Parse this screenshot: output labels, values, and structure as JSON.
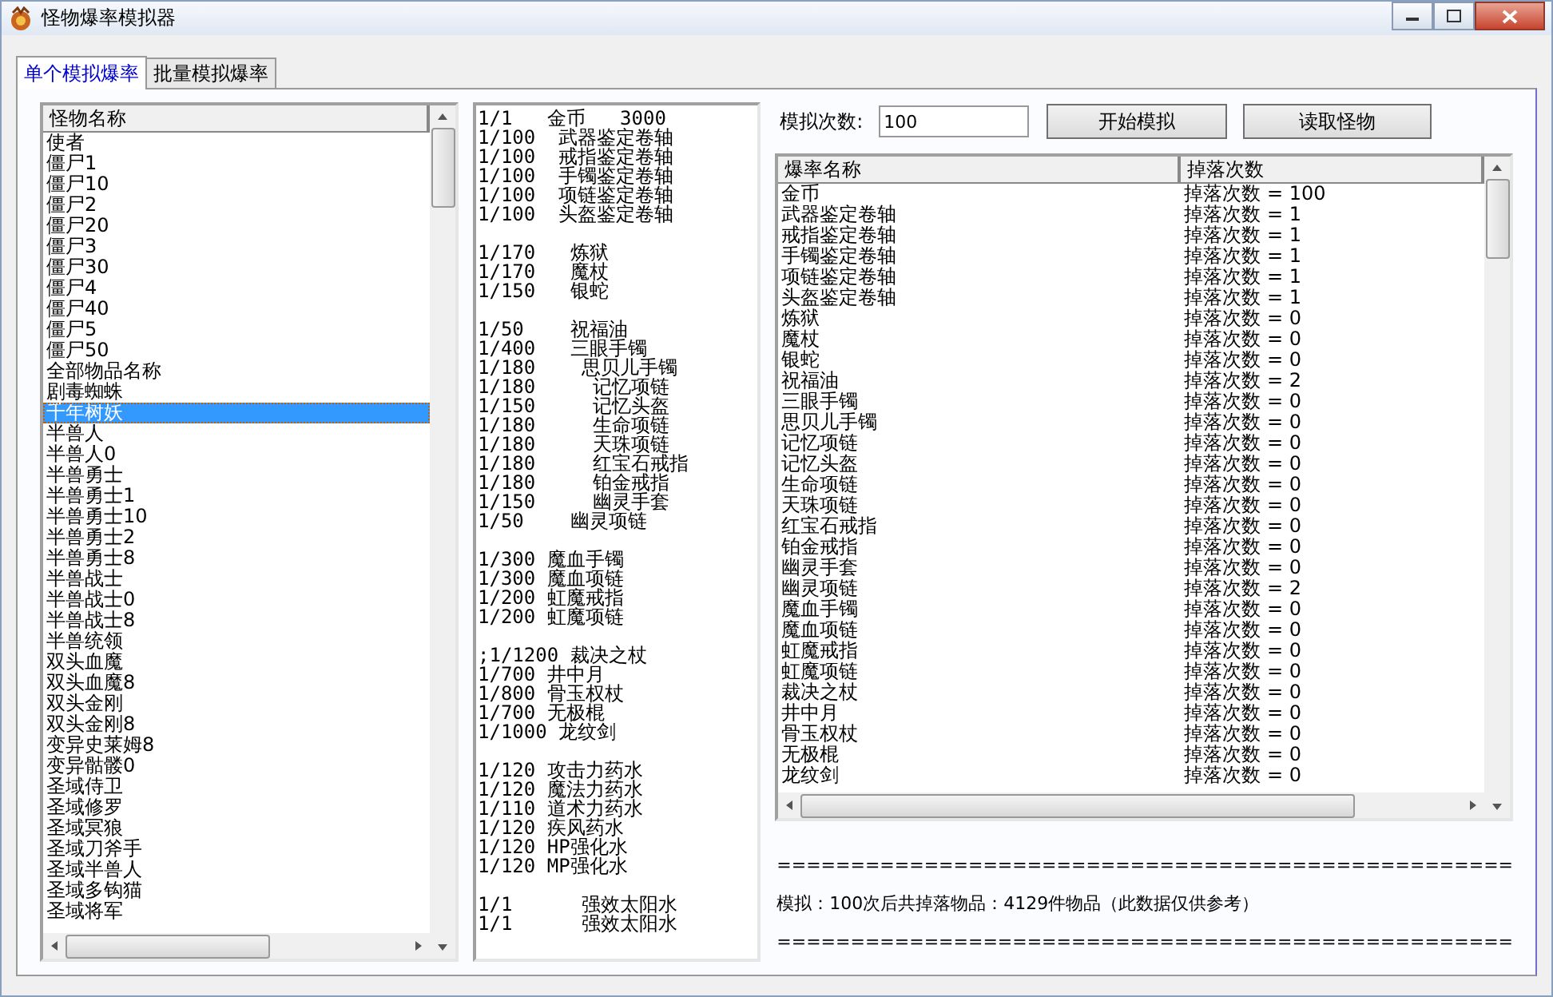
{
  "window": {
    "title": "怪物爆率模拟器"
  },
  "tabs": [
    {
      "label": "单个模拟爆率",
      "selected": true
    },
    {
      "label": "批量模拟爆率",
      "selected": false
    }
  ],
  "monster_list": {
    "header": "怪物名称",
    "items": [
      {
        "label": "使者",
        "selected": false
      },
      {
        "label": "僵尸1",
        "selected": false
      },
      {
        "label": "僵尸10",
        "selected": false
      },
      {
        "label": "僵尸2",
        "selected": false
      },
      {
        "label": "僵尸20",
        "selected": false
      },
      {
        "label": "僵尸3",
        "selected": false
      },
      {
        "label": "僵尸30",
        "selected": false
      },
      {
        "label": "僵尸4",
        "selected": false
      },
      {
        "label": "僵尸40",
        "selected": false
      },
      {
        "label": "僵尸5",
        "selected": false
      },
      {
        "label": "僵尸50",
        "selected": false
      },
      {
        "label": "全部物品名称",
        "selected": false
      },
      {
        "label": "剧毒蜘蛛",
        "selected": false
      },
      {
        "label": "千年树妖",
        "selected": true
      },
      {
        "label": "半兽人",
        "selected": false
      },
      {
        "label": "半兽人0",
        "selected": false
      },
      {
        "label": "半兽勇士",
        "selected": false
      },
      {
        "label": "半兽勇士1",
        "selected": false
      },
      {
        "label": "半兽勇士10",
        "selected": false
      },
      {
        "label": "半兽勇士2",
        "selected": false
      },
      {
        "label": "半兽勇士8",
        "selected": false
      },
      {
        "label": "半兽战士",
        "selected": false
      },
      {
        "label": "半兽战士0",
        "selected": false
      },
      {
        "label": "半兽战士8",
        "selected": false
      },
      {
        "label": "半兽统领",
        "selected": false
      },
      {
        "label": "双头血魔",
        "selected": false
      },
      {
        "label": "双头血魔8",
        "selected": false
      },
      {
        "label": "双头金刚",
        "selected": false
      },
      {
        "label": "双头金刚8",
        "selected": false
      },
      {
        "label": "变异史莱姆8",
        "selected": false
      },
      {
        "label": "变异骷髅0",
        "selected": false
      },
      {
        "label": "圣域侍卫",
        "selected": false
      },
      {
        "label": "圣域修罗",
        "selected": false
      },
      {
        "label": "圣域冥狼",
        "selected": false
      },
      {
        "label": "圣域刀斧手",
        "selected": false
      },
      {
        "label": "圣域半兽人",
        "selected": false
      },
      {
        "label": "圣域多钩猫",
        "selected": false
      },
      {
        "label": "圣域将军",
        "selected": false
      }
    ]
  },
  "drop_script": [
    [
      "1/1   金币   3000",
      "1/100  武器鉴定卷轴",
      "1/100  戒指鉴定卷轴",
      "1/100  手镯鉴定卷轴",
      "1/100  项链鉴定卷轴",
      "1/100  头盔鉴定卷轴"
    ],
    [
      "1/170   炼狱",
      "1/170   魔杖",
      "1/150   银蛇"
    ],
    [
      "1/50    祝福油",
      "1/400   三眼手镯",
      "1/180    思贝儿手镯",
      "1/180     记忆项链",
      "1/150     记忆头盔",
      "1/180     生命项链",
      "1/180     天珠项链",
      "1/180     红宝石戒指",
      "1/180     铂金戒指",
      "1/150     幽灵手套",
      "1/50    幽灵项链"
    ],
    [
      "1/300 魔血手镯",
      "1/300 魔血项链",
      "1/200 虹魔戒指",
      "1/200 虹魔项链"
    ],
    [
      ";1/1200 裁决之杖",
      "1/700 井中月",
      "1/800 骨玉权杖",
      "1/700 无极棍",
      "1/1000 龙纹剑"
    ],
    [
      "1/120 攻击力药水",
      "1/120 魔法力药水",
      "1/110 道术力药水",
      "1/120 疾风药水",
      "1/120 HP强化水",
      "1/120 MP强化水"
    ],
    [
      "1/1      强效太阳水",
      "1/1      强效太阳水"
    ]
  ],
  "simulation": {
    "count_label": "模拟次数:",
    "count_value": "100",
    "buttons": [
      "开始模拟",
      "读取怪物"
    ]
  },
  "results_table": {
    "columns": [
      "爆率名称",
      "掉落次数"
    ],
    "rows": [
      [
        "金币",
        "掉落次数 = 100"
      ],
      [
        "武器鉴定卷轴",
        "掉落次数 = 1"
      ],
      [
        "戒指鉴定卷轴",
        "掉落次数 = 1"
      ],
      [
        "手镯鉴定卷轴",
        "掉落次数 = 1"
      ],
      [
        "项链鉴定卷轴",
        "掉落次数 = 1"
      ],
      [
        "头盔鉴定卷轴",
        "掉落次数 = 1"
      ],
      [
        "炼狱",
        "掉落次数 = 0"
      ],
      [
        "魔杖",
        "掉落次数 = 0"
      ],
      [
        "银蛇",
        "掉落次数 = 0"
      ],
      [
        "祝福油",
        "掉落次数 = 2"
      ],
      [
        "三眼手镯",
        "掉落次数 = 0"
      ],
      [
        "思贝儿手镯",
        "掉落次数 = 0"
      ],
      [
        "记忆项链",
        "掉落次数 = 0"
      ],
      [
        "记忆头盔",
        "掉落次数 = 0"
      ],
      [
        "生命项链",
        "掉落次数 = 0"
      ],
      [
        "天珠项链",
        "掉落次数 = 0"
      ],
      [
        "红宝石戒指",
        "掉落次数 = 0"
      ],
      [
        "铂金戒指",
        "掉落次数 = 0"
      ],
      [
        "幽灵手套",
        "掉落次数 = 0"
      ],
      [
        "幽灵项链",
        "掉落次数 = 2"
      ],
      [
        "魔血手镯",
        "掉落次数 = 0"
      ],
      [
        "魔血项链",
        "掉落次数 = 0"
      ],
      [
        "虹魔戒指",
        "掉落次数 = 0"
      ],
      [
        "虹魔项链",
        "掉落次数 = 0"
      ],
      [
        "裁决之杖",
        "掉落次数 = 0"
      ],
      [
        "井中月",
        "掉落次数 = 0"
      ],
      [
        "骨玉权杖",
        "掉落次数 = 0"
      ],
      [
        "无极棍",
        "掉落次数 = 0"
      ],
      [
        "龙纹剑",
        "掉落次数 = 0"
      ]
    ]
  },
  "summary": [
    "==================================================",
    "模拟：100次后共掉落物品：4129件物品（此数据仅供参考）",
    "=================================================="
  ]
}
